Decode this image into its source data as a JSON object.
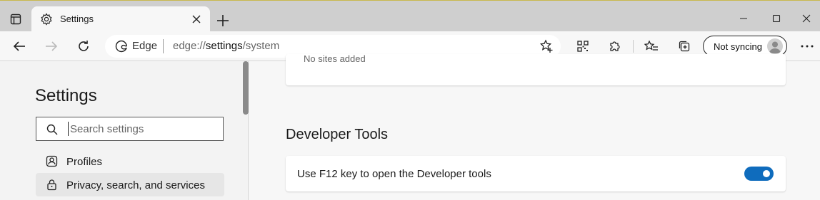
{
  "tab": {
    "title": "Settings"
  },
  "omnibox": {
    "site_label": "Edge",
    "url_prefix": "edge://",
    "url_strong": "settings",
    "url_suffix": "/system"
  },
  "profile": {
    "sync_label": "Not syncing"
  },
  "sidebar": {
    "heading": "Settings",
    "search_placeholder": "Search settings",
    "items": [
      {
        "label": "Profiles",
        "icon": "profile-icon",
        "active": false
      },
      {
        "label": "Privacy, search, and services",
        "icon": "lock-icon",
        "active": true
      }
    ]
  },
  "main": {
    "top_card_text": "No sites added",
    "section_title": "Developer Tools",
    "setting": {
      "label": "Use F12 key to open the Developer tools",
      "enabled": true
    }
  },
  "colors": {
    "accent": "#0f6cbd",
    "tabbar": "#cfcfcf",
    "toolbar": "#f7f7f7"
  }
}
